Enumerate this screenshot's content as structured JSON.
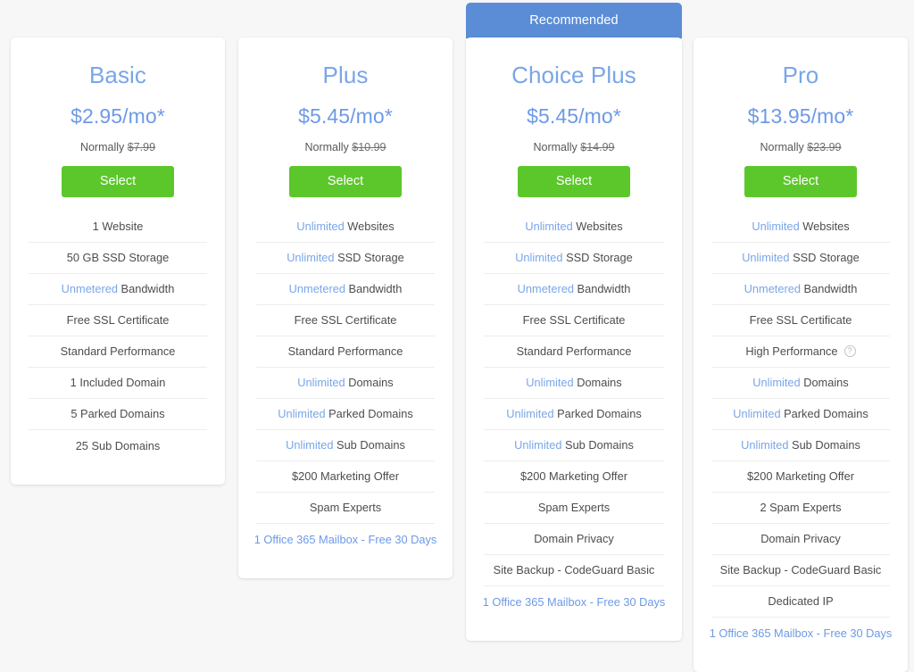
{
  "colors": {
    "accent_blue": "#79a6e8",
    "ribbon_blue": "#5b8dd6",
    "select_green": "#5cc72b",
    "page_background": "#f7f7f8",
    "card_background": "#ffffff",
    "divider": "#ededee",
    "body_text": "#4c4d4f"
  },
  "ribbon": {
    "label": "Recommended"
  },
  "plans": [
    {
      "name": "Basic",
      "price": "$2.95/mo*",
      "normally_prefix": "Normally",
      "normally_price": "$7.99",
      "select_label": "Select",
      "features": [
        {
          "highlight": "",
          "text": "1 Website",
          "link": false,
          "help": false
        },
        {
          "highlight": "",
          "text": "50 GB SSD Storage",
          "link": false,
          "help": false
        },
        {
          "highlight": "Unmetered",
          "text": "Bandwidth",
          "link": false,
          "help": false
        },
        {
          "highlight": "",
          "text": "Free SSL Certificate",
          "link": false,
          "help": false
        },
        {
          "highlight": "",
          "text": "Standard Performance",
          "link": false,
          "help": false
        },
        {
          "highlight": "",
          "text": "1 Included Domain",
          "link": false,
          "help": false
        },
        {
          "highlight": "",
          "text": "5 Parked Domains",
          "link": false,
          "help": false
        },
        {
          "highlight": "",
          "text": "25 Sub Domains",
          "link": false,
          "help": false
        }
      ]
    },
    {
      "name": "Plus",
      "price": "$5.45/mo*",
      "normally_prefix": "Normally",
      "normally_price": "$10.99",
      "select_label": "Select",
      "features": [
        {
          "highlight": "Unlimited",
          "text": "Websites",
          "link": false,
          "help": false
        },
        {
          "highlight": "Unlimited",
          "text": "SSD Storage",
          "link": false,
          "help": false
        },
        {
          "highlight": "Unmetered",
          "text": "Bandwidth",
          "link": false,
          "help": false
        },
        {
          "highlight": "",
          "text": "Free SSL Certificate",
          "link": false,
          "help": false
        },
        {
          "highlight": "",
          "text": "Standard Performance",
          "link": false,
          "help": false
        },
        {
          "highlight": "Unlimited",
          "text": "Domains",
          "link": false,
          "help": false
        },
        {
          "highlight": "Unlimited",
          "text": "Parked Domains",
          "link": false,
          "help": false
        },
        {
          "highlight": "Unlimited",
          "text": "Sub Domains",
          "link": false,
          "help": false
        },
        {
          "highlight": "",
          "text": "$200 Marketing Offer",
          "link": false,
          "help": false
        },
        {
          "highlight": "",
          "text": "Spam Experts",
          "link": false,
          "help": false
        },
        {
          "highlight": "",
          "text": "1 Office 365 Mailbox - Free 30 Days",
          "link": true,
          "help": false
        }
      ]
    },
    {
      "name": "Choice Plus",
      "price": "$5.45/mo*",
      "normally_prefix": "Normally",
      "normally_price": "$14.99",
      "select_label": "Select",
      "recommended": true,
      "features": [
        {
          "highlight": "Unlimited",
          "text": "Websites",
          "link": false,
          "help": false
        },
        {
          "highlight": "Unlimited",
          "text": "SSD Storage",
          "link": false,
          "help": false
        },
        {
          "highlight": "Unmetered",
          "text": "Bandwidth",
          "link": false,
          "help": false
        },
        {
          "highlight": "",
          "text": "Free SSL Certificate",
          "link": false,
          "help": false
        },
        {
          "highlight": "",
          "text": "Standard Performance",
          "link": false,
          "help": false
        },
        {
          "highlight": "Unlimited",
          "text": "Domains",
          "link": false,
          "help": false
        },
        {
          "highlight": "Unlimited",
          "text": "Parked Domains",
          "link": false,
          "help": false
        },
        {
          "highlight": "Unlimited",
          "text": "Sub Domains",
          "link": false,
          "help": false
        },
        {
          "highlight": "",
          "text": "$200 Marketing Offer",
          "link": false,
          "help": false
        },
        {
          "highlight": "",
          "text": "Spam Experts",
          "link": false,
          "help": false
        },
        {
          "highlight": "",
          "text": "Domain Privacy",
          "link": false,
          "help": false
        },
        {
          "highlight": "",
          "text": "Site Backup - CodeGuard Basic",
          "link": false,
          "help": false
        },
        {
          "highlight": "",
          "text": "1 Office 365 Mailbox - Free 30 Days",
          "link": true,
          "help": false
        }
      ]
    },
    {
      "name": "Pro",
      "price": "$13.95/mo*",
      "normally_prefix": "Normally",
      "normally_price": "$23.99",
      "select_label": "Select",
      "features": [
        {
          "highlight": "Unlimited",
          "text": "Websites",
          "link": false,
          "help": false
        },
        {
          "highlight": "Unlimited",
          "text": "SSD Storage",
          "link": false,
          "help": false
        },
        {
          "highlight": "Unmetered",
          "text": "Bandwidth",
          "link": false,
          "help": false
        },
        {
          "highlight": "",
          "text": "Free SSL Certificate",
          "link": false,
          "help": false
        },
        {
          "highlight": "",
          "text": "High Performance",
          "link": false,
          "help": true
        },
        {
          "highlight": "Unlimited",
          "text": "Domains",
          "link": false,
          "help": false
        },
        {
          "highlight": "Unlimited",
          "text": "Parked Domains",
          "link": false,
          "help": false
        },
        {
          "highlight": "Unlimited",
          "text": "Sub Domains",
          "link": false,
          "help": false
        },
        {
          "highlight": "",
          "text": "$200 Marketing Offer",
          "link": false,
          "help": false
        },
        {
          "highlight": "",
          "text": "2 Spam Experts",
          "link": false,
          "help": false
        },
        {
          "highlight": "",
          "text": "Domain Privacy",
          "link": false,
          "help": false
        },
        {
          "highlight": "",
          "text": "Site Backup - CodeGuard Basic",
          "link": false,
          "help": false
        },
        {
          "highlight": "",
          "text": "Dedicated IP",
          "link": false,
          "help": false
        },
        {
          "highlight": "",
          "text": "1 Office 365 Mailbox - Free 30 Days",
          "link": true,
          "help": false
        }
      ]
    }
  ],
  "help_icon_glyph": "?"
}
